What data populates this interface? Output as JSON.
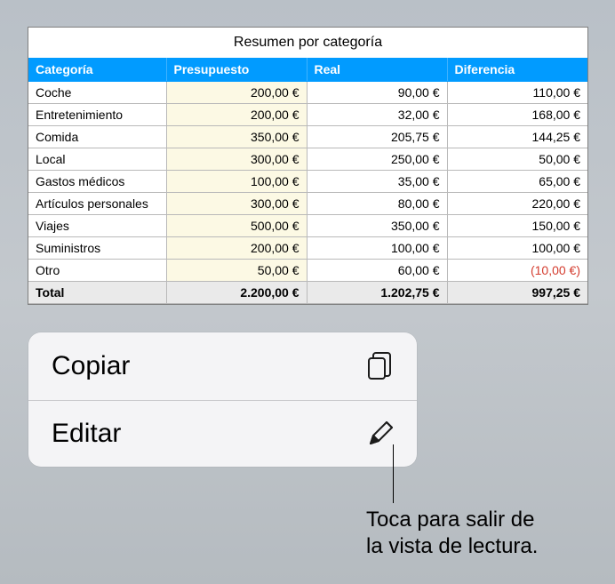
{
  "table": {
    "title": "Resumen por categoría",
    "headers": [
      "Categoría",
      "Presupuesto",
      "Real",
      "Diferencia"
    ],
    "rows": [
      {
        "cat": "Coche",
        "budget": "200,00 €",
        "real": "90,00 €",
        "diff": "110,00 €",
        "neg": false
      },
      {
        "cat": "Entretenimiento",
        "budget": "200,00 €",
        "real": "32,00 €",
        "diff": "168,00 €",
        "neg": false
      },
      {
        "cat": "Comida",
        "budget": "350,00 €",
        "real": "205,75 €",
        "diff": "144,25 €",
        "neg": false
      },
      {
        "cat": "Local",
        "budget": "300,00 €",
        "real": "250,00 €",
        "diff": "50,00 €",
        "neg": false
      },
      {
        "cat": "Gastos médicos",
        "budget": "100,00 €",
        "real": "35,00 €",
        "diff": "65,00 €",
        "neg": false
      },
      {
        "cat": "Artículos personales",
        "budget": "300,00 €",
        "real": "80,00 €",
        "diff": "220,00 €",
        "neg": false
      },
      {
        "cat": "Viajes",
        "budget": "500,00 €",
        "real": "350,00 €",
        "diff": "150,00 €",
        "neg": false
      },
      {
        "cat": "Suministros",
        "budget": "200,00 €",
        "real": "100,00 €",
        "diff": "100,00 €",
        "neg": false
      },
      {
        "cat": "Otro",
        "budget": "50,00 €",
        "real": "60,00 €",
        "diff": "(10,00 €)",
        "neg": true
      }
    ],
    "total": {
      "cat": "Total",
      "budget": "2.200,00 €",
      "real": "1.202,75 €",
      "diff": "997,25 €"
    }
  },
  "menu": {
    "copy_label": "Copiar",
    "edit_label": "Editar"
  },
  "callout": "Toca para salir de\nla vista de lectura."
}
